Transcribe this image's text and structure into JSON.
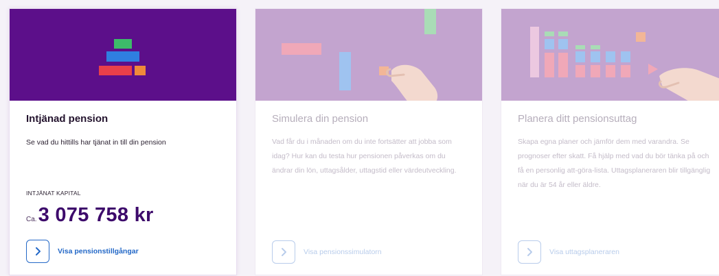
{
  "cards": [
    {
      "title": "Intjänad pension",
      "description": "Se vad du hittills har tjänat in till din pension",
      "capital_label": "INTJÄNAT KAPITAL",
      "amount_prefix": "Ca.",
      "amount": "3 075 758 kr",
      "link_label": "Visa pensionstillgångar",
      "state": "active"
    },
    {
      "title": "Simulera din pension",
      "description": "Vad får du i månaden om du inte fortsätter att jobba som idag? Hur kan du testa hur pensionen påverkas om du ändrar din lön, uttagsålder, uttagstid eller värdeutveckling.",
      "link_label": "Visa pensionssimulatorn",
      "state": "disabled"
    },
    {
      "title": "Planera ditt pensionsuttag",
      "description": "Skapa egna planer och jämför dem med varandra. Se prognoser efter skatt. Få hjälp med vad du bör tänka på och få en personlig att-göra-lista. Uttagsplaneraren blir tillgänglig när du är 54 år eller äldre.",
      "link_label": "Visa uttagsplaneraren",
      "state": "disabled"
    }
  ],
  "icons": {
    "link": "chevron-right-icon"
  },
  "colors": {
    "active_banner": "#5c0f8a",
    "disabled_banner": "#c3a4cf",
    "link_blue": "#2368c7",
    "amount": "#3d0a6b"
  }
}
